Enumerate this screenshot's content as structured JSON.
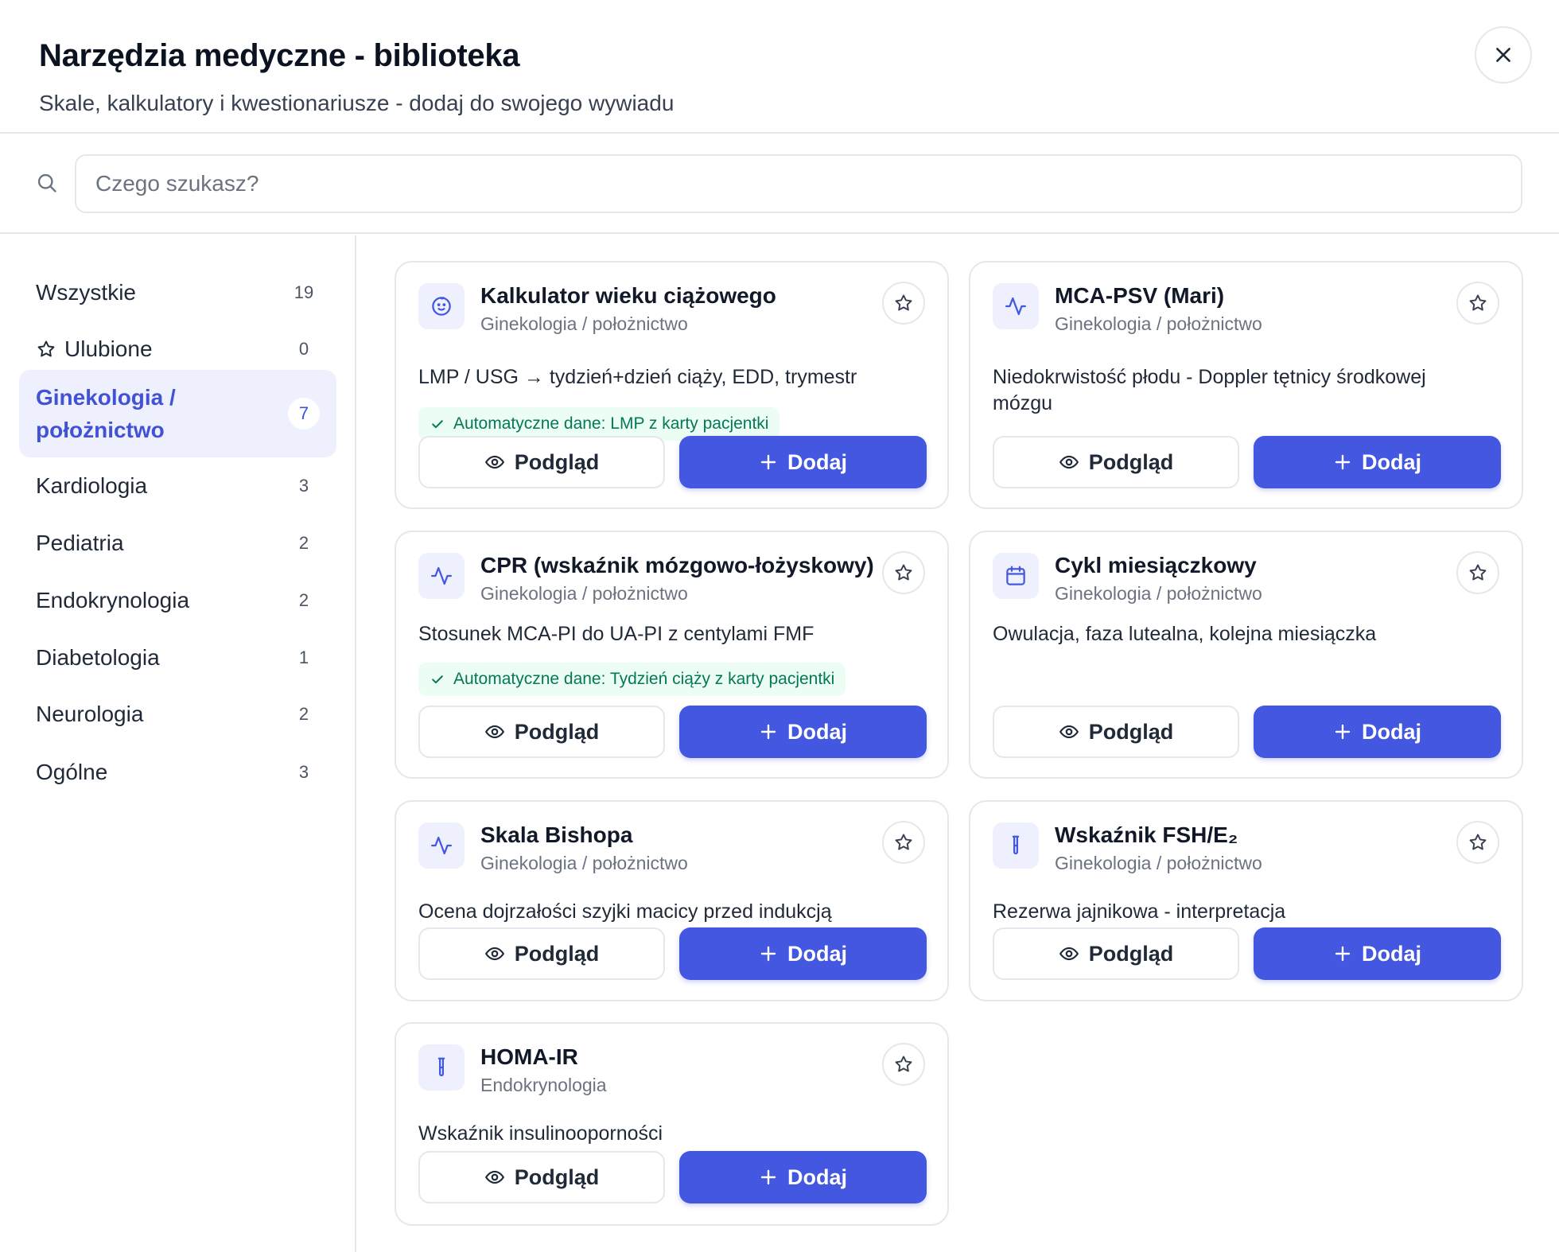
{
  "header": {
    "title": "Narzędzia medyczne - biblioteka",
    "subtitle": "Skale, kalkulatory i kwestionariusze - dodaj do swojego wywiadu"
  },
  "search": {
    "placeholder": "Czego szukasz?",
    "value": ""
  },
  "sidebar": {
    "categories": [
      {
        "label": "Wszystkie",
        "count": "19",
        "icon": null,
        "active": false
      },
      {
        "label": "Ulubione",
        "count": "0",
        "icon": "star-icon",
        "active": false
      },
      {
        "label": "Ginekologia / położnictwo",
        "count": "7",
        "icon": null,
        "active": true
      },
      {
        "label": "Kardiologia",
        "count": "3",
        "icon": null,
        "active": false
      },
      {
        "label": "Pediatria",
        "count": "2",
        "icon": null,
        "active": false
      },
      {
        "label": "Endokrynologia",
        "count": "2",
        "icon": null,
        "active": false
      },
      {
        "label": "Diabetologia",
        "count": "1",
        "icon": null,
        "active": false
      },
      {
        "label": "Neurologia",
        "count": "2",
        "icon": null,
        "active": false
      },
      {
        "label": "Ogólne",
        "count": "3",
        "icon": null,
        "active": false
      }
    ]
  },
  "tools": [
    {
      "title": "Kalkulator wieku ciążowego",
      "category": "Ginekologia / położnictwo",
      "description": "LMP / USG → tydzień+dzień ciąży, EDD, trymestr",
      "auto": "Automatyczne dane: LMP z karty pacjentki",
      "icon": "baby-icon"
    },
    {
      "title": "MCA-PSV (Mari)",
      "category": "Ginekologia / położnictwo",
      "description": "Niedokrwistość płodu - Doppler tętnicy środkowej mózgu",
      "auto": null,
      "icon": "activity-icon"
    },
    {
      "title": "CPR (wskaźnik mózgowo-łożyskowy)",
      "category": "Ginekologia / położnictwo",
      "description": "Stosunek MCA-PI do UA-PI z centylami FMF",
      "auto": "Automatyczne dane: Tydzień ciąży z karty pacjentki",
      "icon": "activity-icon"
    },
    {
      "title": "Cykl miesiączkowy",
      "category": "Ginekologia / położnictwo",
      "description": "Owulacja, faza lutealna, kolejna miesiączka",
      "auto": null,
      "icon": "calendar-icon"
    },
    {
      "title": "Skala Bishopa",
      "category": "Ginekologia / położnictwo",
      "description": "Ocena dojrzałości szyjki macicy przed indukcją",
      "auto": null,
      "icon": "activity-icon"
    },
    {
      "title": "Wskaźnik FSH/E₂",
      "category": "Ginekologia / położnictwo",
      "description": "Rezerwa jajnikowa - interpretacja",
      "auto": null,
      "icon": "test-tube-icon"
    },
    {
      "title": "HOMA-IR",
      "category": "Endokrynologia",
      "description": "Wskaźnik insulinooporności",
      "auto": null,
      "icon": "test-tube-icon"
    }
  ],
  "actions": {
    "preview_label": "Podgląd",
    "add_label": "Dodaj"
  },
  "colors": {
    "primary": "#4357e0",
    "active_bg": "#eef0fd",
    "active_text": "#4152d6",
    "success_bg": "#ecfdf3",
    "success_text": "#047857"
  }
}
